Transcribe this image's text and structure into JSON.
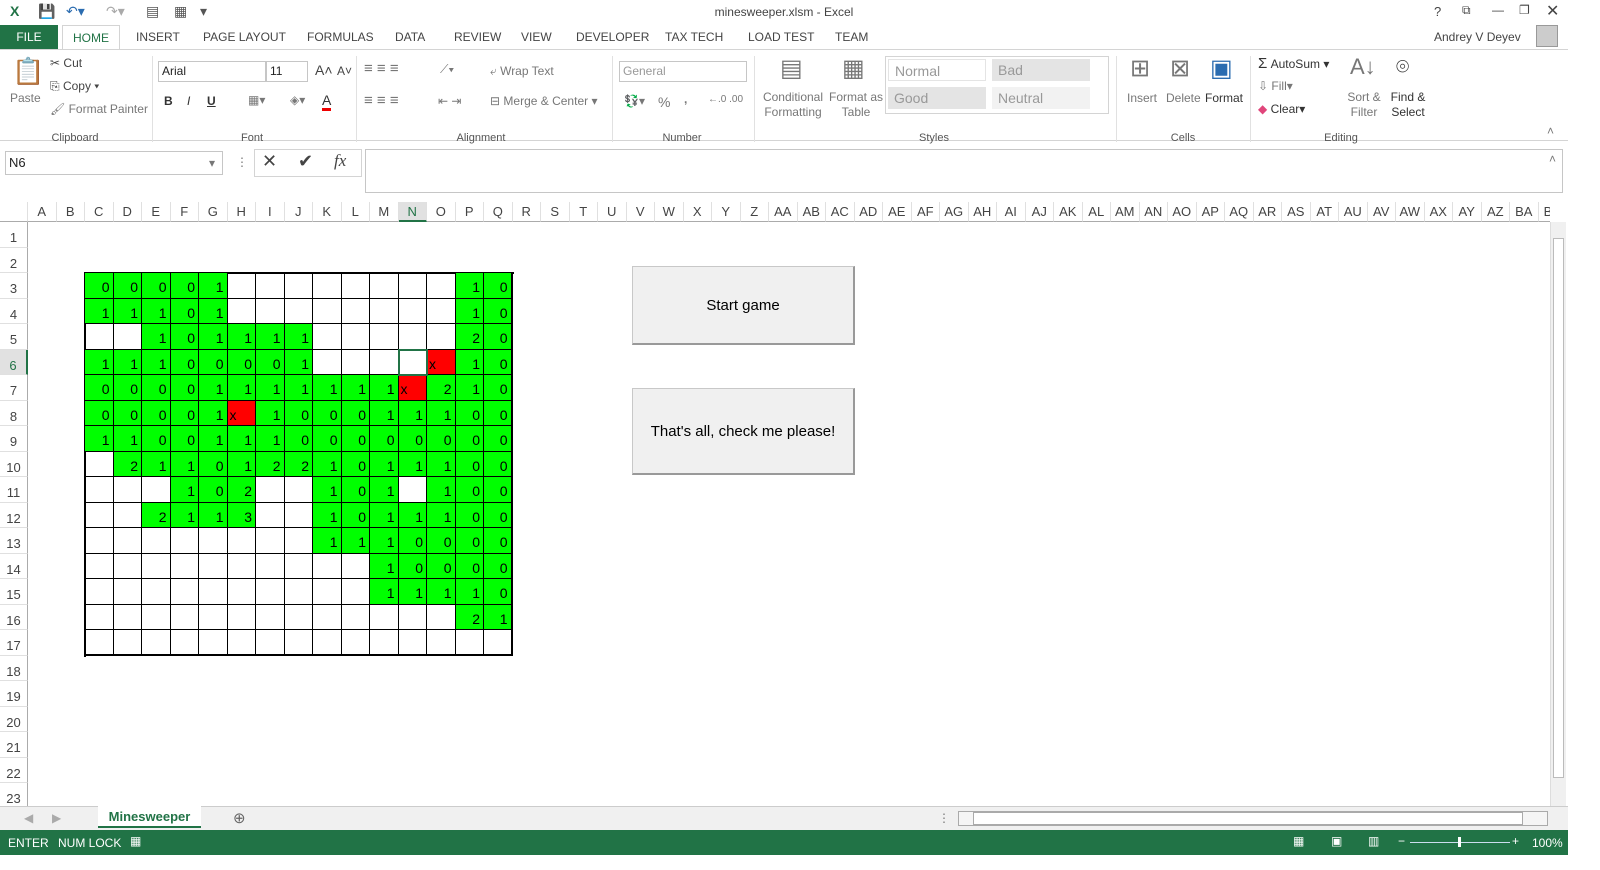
{
  "window": {
    "title": "minesweeper.xlsm - Excel",
    "user": "Andrey V Deyev",
    "help": "?"
  },
  "tabs": [
    "FILE",
    "HOME",
    "INSERT",
    "PAGE LAYOUT",
    "FORMULAS",
    "DATA",
    "REVIEW",
    "VIEW",
    "DEVELOPER",
    "TAX TECH",
    "LOAD TEST",
    "TEAM"
  ],
  "ribbon": {
    "clipboard": {
      "paste": "Paste",
      "cut": "Cut",
      "copy": "Copy",
      "format_painter": "Format Painter",
      "label": "Clipboard"
    },
    "font": {
      "name": "Arial",
      "size": "11",
      "bold": "B",
      "italic": "I",
      "underline": "U",
      "label": "Font"
    },
    "alignment": {
      "wrap": "Wrap Text",
      "merge": "Merge & Center",
      "label": "Alignment"
    },
    "number": {
      "format": "General",
      "percent": "%",
      "comma": ",",
      "label": "Number"
    },
    "styles": {
      "conditional": "Conditional Formatting",
      "format_table": "Format as Table",
      "normal": "Normal",
      "bad": "Bad",
      "good": "Good",
      "neutral": "Neutral",
      "label": "Styles"
    },
    "cells": {
      "insert": "Insert",
      "delete": "Delete",
      "format": "Format",
      "label": "Cells"
    },
    "editing": {
      "autosum": "AutoSum",
      "fill": "Fill",
      "clear": "Clear",
      "sort": "Sort & Filter",
      "find": "Find & Select",
      "label": "Editing"
    }
  },
  "formula_bar": {
    "name_box": "N6",
    "formula": "",
    "fx": "fx"
  },
  "columns": [
    "A",
    "B",
    "C",
    "D",
    "E",
    "F",
    "G",
    "H",
    "I",
    "J",
    "K",
    "L",
    "M",
    "N",
    "O",
    "P",
    "Q",
    "R",
    "S",
    "T",
    "U",
    "V",
    "W",
    "X",
    "Y",
    "Z",
    "AA",
    "AB",
    "AC",
    "AD",
    "AE",
    "AF",
    "AG",
    "AH",
    "AI",
    "AJ",
    "AK",
    "AL",
    "AM",
    "AN",
    "AO",
    "AP",
    "AQ",
    "AR",
    "AS",
    "AT",
    "AU",
    "AV",
    "AW",
    "AX",
    "AY",
    "AZ",
    "BA",
    "BB"
  ],
  "selected_cell": {
    "column": "N",
    "row": 6
  },
  "board": {
    "colors": {
      "opened": "#00ff00",
      "mine": "#ff0000",
      "closed": "#ffffff"
    },
    "rows": [
      [
        "0",
        "0",
        "0",
        "0",
        "1",
        "",
        "",
        "",
        "",
        "",
        "",
        "",
        "",
        "1",
        "0"
      ],
      [
        "1",
        "1",
        "1",
        "0",
        "1",
        "",
        "",
        "",
        "",
        "",
        "",
        "",
        "",
        "1",
        "0"
      ],
      [
        "",
        "",
        "1",
        "0",
        "1",
        "1",
        "1",
        "1",
        "",
        "",
        "",
        "",
        "",
        "2",
        "0"
      ],
      [
        "1",
        "1",
        "1",
        "0",
        "0",
        "0",
        "0",
        "1",
        "",
        "",
        "",
        "",
        "x",
        "1",
        "0"
      ],
      [
        "0",
        "0",
        "0",
        "0",
        "1",
        "1",
        "1",
        "1",
        "1",
        "1",
        "1",
        "x",
        "2",
        "1",
        "0"
      ],
      [
        "0",
        "0",
        "0",
        "0",
        "1",
        "x",
        "1",
        "0",
        "0",
        "0",
        "1",
        "1",
        "1",
        "0",
        "0"
      ],
      [
        "1",
        "1",
        "0",
        "0",
        "1",
        "1",
        "1",
        "0",
        "0",
        "0",
        "0",
        "0",
        "0",
        "0",
        "0"
      ],
      [
        "",
        "2",
        "1",
        "1",
        "0",
        "1",
        "2",
        "2",
        "1",
        "0",
        "1",
        "1",
        "1",
        "0",
        "0"
      ],
      [
        "",
        "",
        "",
        "1",
        "0",
        "2",
        "",
        "",
        "1",
        "0",
        "1",
        "",
        "1",
        "0",
        "0"
      ],
      [
        "",
        "",
        "2",
        "1",
        "1",
        "3",
        "",
        "",
        "1",
        "0",
        "1",
        "1",
        "1",
        "0",
        "0"
      ],
      [
        "",
        "",
        "",
        "",
        "",
        "",
        "",
        "",
        "1",
        "1",
        "1",
        "0",
        "0",
        "0",
        "0"
      ],
      [
        "",
        "",
        "",
        "",
        "",
        "",
        "",
        "",
        "",
        "",
        "1",
        "0",
        "0",
        "0",
        "0"
      ],
      [
        "",
        "",
        "",
        "",
        "",
        "",
        "",
        "",
        "",
        "",
        "1",
        "1",
        "1",
        "1",
        "0"
      ],
      [
        "",
        "",
        "",
        "",
        "",
        "",
        "",
        "",
        "",
        "",
        "",
        "",
        "",
        "2",
        "1"
      ],
      [
        "",
        "",
        "",
        "",
        "",
        "",
        "",
        "",
        "",
        "",
        "",
        "",
        "",
        "",
        ""
      ]
    ]
  },
  "buttons": {
    "start": "Start game",
    "check": "That's all, check me please!"
  },
  "sheet_tab": "Minesweeper",
  "status": {
    "mode": "ENTER",
    "numlock": "NUM LOCK",
    "zoom": "100%"
  }
}
